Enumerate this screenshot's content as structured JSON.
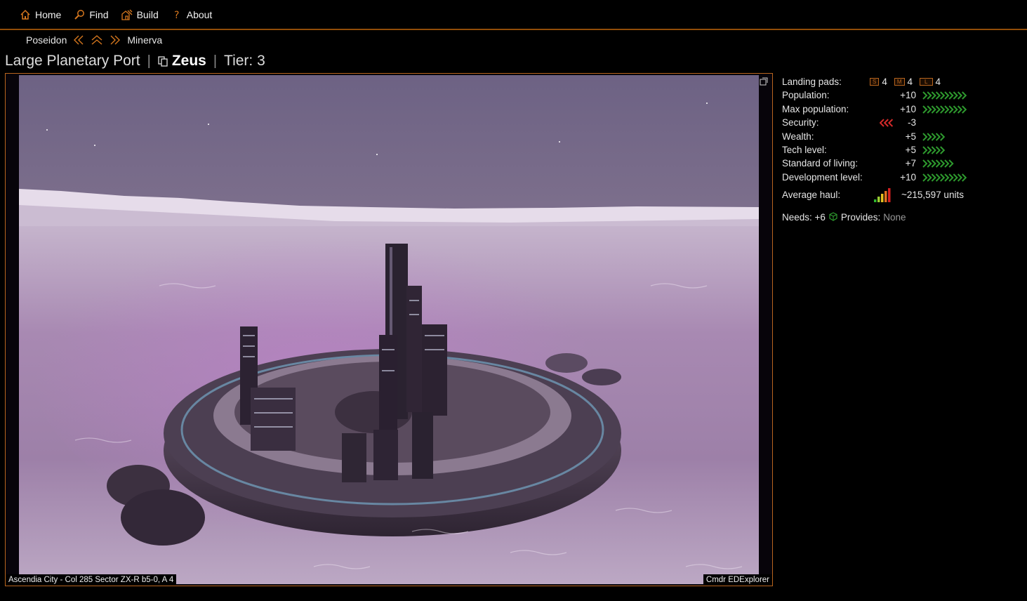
{
  "nav": {
    "items": [
      {
        "label": "Home",
        "icon": "home-icon"
      },
      {
        "label": "Find",
        "icon": "search-icon"
      },
      {
        "label": "Build",
        "icon": "build-icon"
      },
      {
        "label": "About",
        "icon": "question-icon"
      }
    ]
  },
  "subnav": {
    "prev_label": "Poseidon",
    "next_label": "Minerva"
  },
  "title": {
    "type": "Large Planetary Port",
    "system": "Zeus",
    "tier": "Tier: 3"
  },
  "image": {
    "caption_location": "Ascendia City - Col 285 Sector ZX-R b5-0, A 4",
    "caption_credit": "Cmdr EDExplorer"
  },
  "stats": {
    "landing_pads": {
      "label": "Landing pads:",
      "small": "4",
      "medium": "4",
      "large": "4",
      "s_badge": "S",
      "m_badge": "M",
      "l_badge": "L"
    },
    "rows": [
      {
        "label": "Population:",
        "value": "+10",
        "arrows": 10,
        "direction": "up"
      },
      {
        "label": "Max population:",
        "value": "+10",
        "arrows": 10,
        "direction": "up"
      },
      {
        "label": "Security:",
        "value": "-3",
        "arrows": 3,
        "direction": "down"
      },
      {
        "label": "Wealth:",
        "value": "+5",
        "arrows": 5,
        "direction": "up"
      },
      {
        "label": "Tech level:",
        "value": "+5",
        "arrows": 5,
        "direction": "up"
      },
      {
        "label": "Standard of living:",
        "value": "+7",
        "arrows": 7,
        "direction": "up"
      },
      {
        "label": "Development level:",
        "value": "+10",
        "arrows": 10,
        "direction": "up"
      }
    ],
    "average_haul": {
      "label": "Average haul:",
      "value": "~215,597 units",
      "bars": 5
    },
    "needs": {
      "label": "Needs: +6",
      "provides_label": "Provides:",
      "provides_value": "None"
    }
  },
  "colors": {
    "accent": "#b8651e",
    "positive": "#2e9a2e",
    "negative": "#d42a2a"
  }
}
